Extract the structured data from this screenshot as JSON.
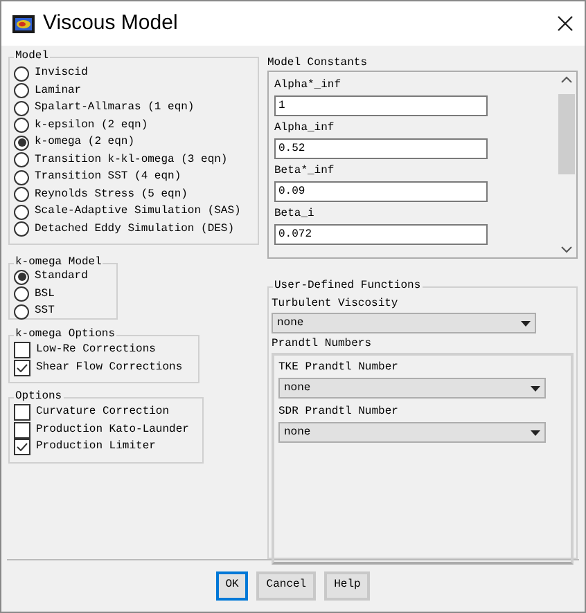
{
  "window": {
    "title": "Viscous Model"
  },
  "model": {
    "label": "Model",
    "options": [
      {
        "label": "Inviscid",
        "selected": false
      },
      {
        "label": "Laminar",
        "selected": false
      },
      {
        "label": "Spalart-Allmaras (1 eqn)",
        "selected": false
      },
      {
        "label": "k-epsilon (2 eqn)",
        "selected": false
      },
      {
        "label": "k-omega (2 eqn)",
        "selected": true
      },
      {
        "label": "Transition k-kl-omega (3 eqn)",
        "selected": false
      },
      {
        "label": "Transition SST (4 eqn)",
        "selected": false
      },
      {
        "label": "Reynolds Stress (5 eqn)",
        "selected": false
      },
      {
        "label": "Scale-Adaptive Simulation (SAS)",
        "selected": false
      },
      {
        "label": "Detached Eddy Simulation (DES)",
        "selected": false
      }
    ]
  },
  "k_omega_model": {
    "label": "k-omega Model",
    "options": [
      {
        "label": "Standard",
        "selected": true
      },
      {
        "label": "BSL",
        "selected": false
      },
      {
        "label": "SST",
        "selected": false
      }
    ]
  },
  "k_omega_options": {
    "label": "k-omega Options",
    "items": [
      {
        "label": "Low-Re Corrections",
        "checked": false
      },
      {
        "label": "Shear Flow Corrections",
        "checked": true
      }
    ]
  },
  "options": {
    "label": "Options",
    "items": [
      {
        "label": "Curvature Correction",
        "checked": false
      },
      {
        "label": "Production Kato-Launder",
        "checked": false
      },
      {
        "label": "Production Limiter",
        "checked": true
      }
    ]
  },
  "model_constants": {
    "label": "Model Constants",
    "fields": [
      {
        "label": "Alpha*_inf",
        "value": "1"
      },
      {
        "label": "Alpha_inf",
        "value": "0.52"
      },
      {
        "label": "Beta*_inf",
        "value": "0.09"
      },
      {
        "label": "Beta_i",
        "value": "0.072"
      }
    ]
  },
  "user_defined_functions": {
    "label": "User-Defined Functions",
    "turbulent_viscosity": {
      "label": "Turbulent Viscosity",
      "value": "none"
    },
    "prandtl_numbers": {
      "label": "Prandtl Numbers",
      "items": [
        {
          "label": "TKE Prandtl Number",
          "value": "none"
        },
        {
          "label": "SDR Prandtl Number",
          "value": "none"
        }
      ]
    }
  },
  "buttons": [
    {
      "label": "OK",
      "selected": true
    },
    {
      "label": "Cancel",
      "selected": false
    },
    {
      "label": "Help",
      "selected": false
    }
  ]
}
